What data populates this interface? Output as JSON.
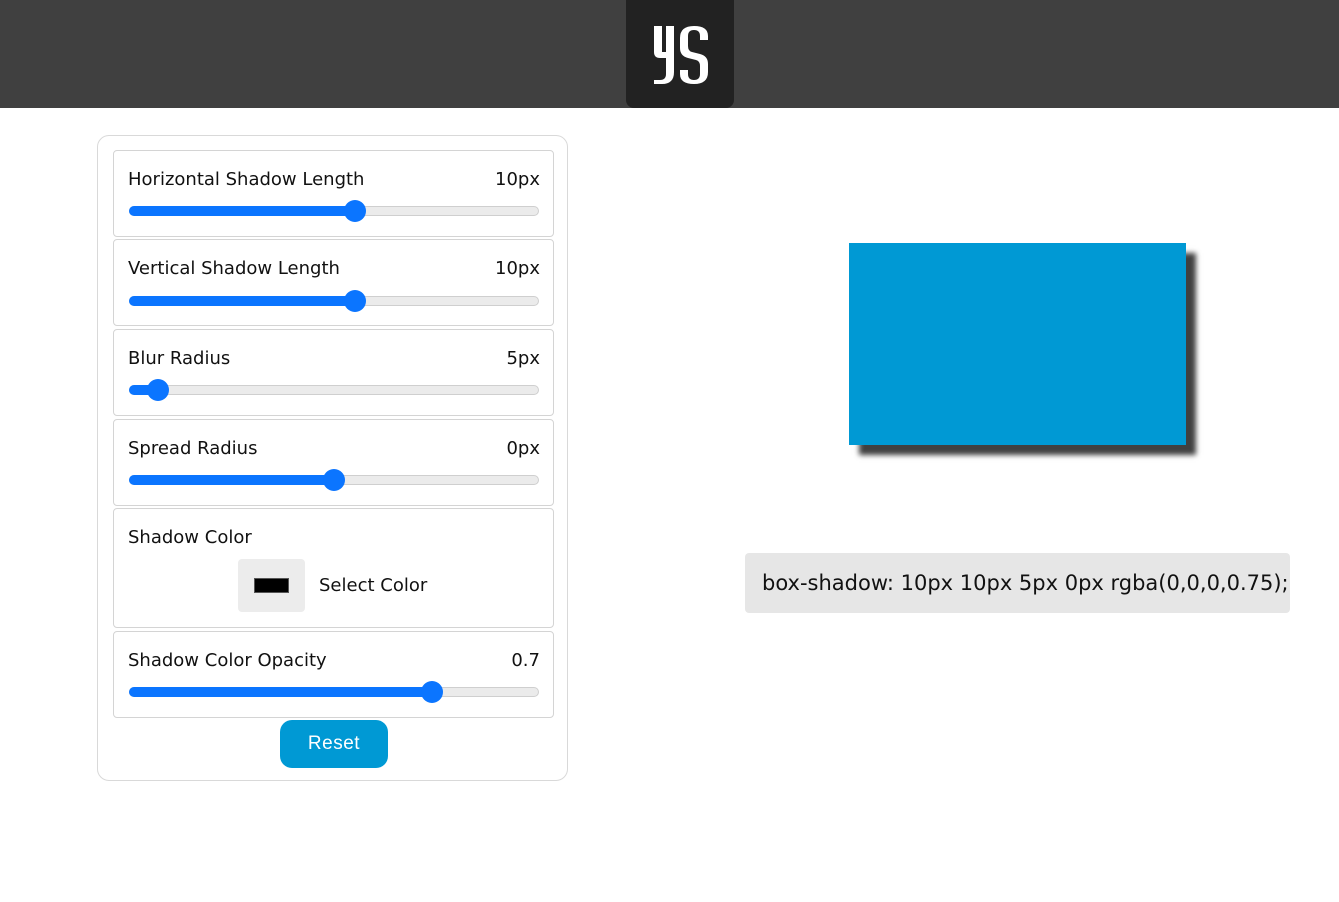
{
  "header": {
    "logo_text": "YS",
    "colors": {
      "bar": "#404040",
      "logo_bg": "#222222"
    }
  },
  "controls": [
    {
      "id": "horizontal",
      "label": "Horizontal Shadow Length",
      "value_text": "10px",
      "fraction": 0.55
    },
    {
      "id": "vertical",
      "label": "Vertical Shadow Length",
      "value_text": "10px",
      "fraction": 0.55
    },
    {
      "id": "blur",
      "label": "Blur Radius",
      "value_text": "5px",
      "fraction": 0.07
    },
    {
      "id": "spread",
      "label": "Spread Radius",
      "value_text": "0px",
      "fraction": 0.5
    },
    {
      "id": "opacity",
      "label": "Shadow Color Opacity",
      "value_text": "0.7",
      "fraction": 0.74
    }
  ],
  "shadow_color": {
    "label": "Shadow Color",
    "button_label": "Select Color",
    "value": "#000000"
  },
  "reset_button": {
    "label": "Reset"
  },
  "preview": {
    "box_color": "#0099d4",
    "shadow_css": "10px 10px 5px 0px rgba(0,0,0,0.75)"
  },
  "output": {
    "css_text": "box-shadow: 10px 10px 5px 0px rgba(0,0,0,0.75);"
  },
  "colors": {
    "accent": "#0b75ff",
    "button": "#0099d4",
    "track": "#ebebeb",
    "output_bg": "#e6e6e6"
  }
}
